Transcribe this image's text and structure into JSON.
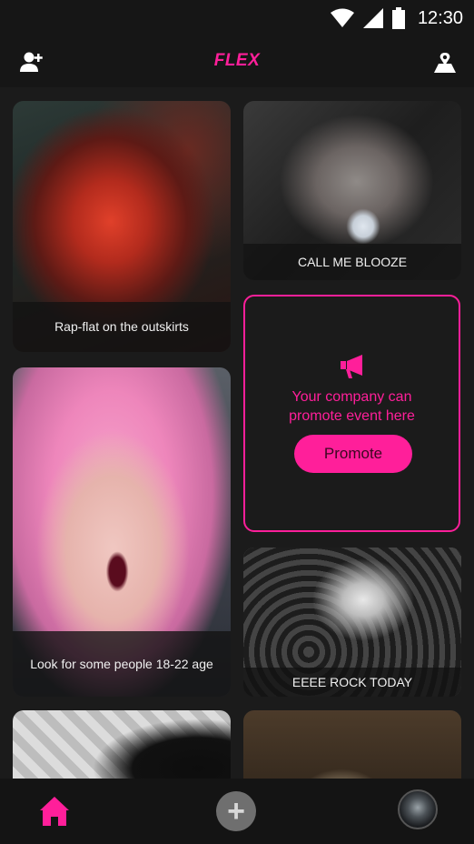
{
  "status_bar": {
    "time": "12:30"
  },
  "app_bar": {
    "title": "FLEX"
  },
  "cards": [
    {
      "id": "rap",
      "caption": "Rap-flat on the outskirts"
    },
    {
      "id": "blooze",
      "caption": "CALL ME BLOOZE"
    },
    {
      "id": "pink",
      "caption": "Look for some people 18-22 age"
    },
    {
      "id": "rock",
      "caption": "EEEE ROCK TODAY"
    }
  ],
  "promo": {
    "text": "Your company can\npromote event here",
    "button_label": "Promote"
  },
  "bottom_nav": {
    "add_symbol": "+"
  },
  "colors": {
    "accent": "#ff1f9a",
    "background": "#1b1b1b",
    "bar": "#161616"
  },
  "icons": [
    "signal-icon",
    "wifi-icon",
    "battery-icon",
    "add-user-icon",
    "map-icon",
    "megaphone-icon",
    "home-icon",
    "plus-icon"
  ]
}
